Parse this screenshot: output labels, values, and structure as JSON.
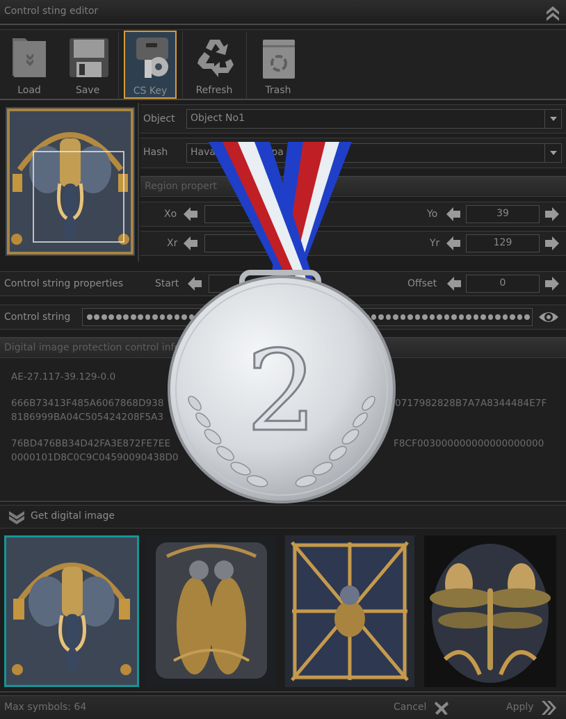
{
  "window": {
    "title": "Control sting editor",
    "collapse_icon": "double-chevron-up-icon"
  },
  "toolbar": {
    "buttons": [
      {
        "label": "Load",
        "icon": "folder-load-icon",
        "active": false
      },
      {
        "label": "Save",
        "icon": "floppy-disk-icon",
        "active": false
      },
      {
        "label": "CS Key",
        "icon": "key-gear-icon",
        "active": true
      },
      {
        "label": "Refresh",
        "icon": "recycle-icon",
        "active": false
      },
      {
        "label": "Trash",
        "icon": "trash-bin-icon",
        "active": false
      }
    ]
  },
  "object_panel": {
    "object_label": "Object",
    "object_value": "Object No1",
    "hash_label": "Hash",
    "hash_value_visible_start": "Hava",
    "hash_value_visible_end": "5 pa",
    "region_header": "Region propert",
    "xo_label": "Xo",
    "xo_value": "",
    "yo_label": "Yo",
    "yo_value": "39",
    "xr_label": "Xr",
    "xr_value": "1",
    "yr_label": "Yr",
    "yr_value": "129"
  },
  "control_string_properties": {
    "label": "Control string properties",
    "start_label": "Start",
    "start_value": "",
    "offset_label": "Offset",
    "offset_value": "0"
  },
  "control_string": {
    "label": "Control string",
    "masked": true,
    "visibility_icon": "eye-icon"
  },
  "info": {
    "header": "Digital image protection control info",
    "lines": [
      {
        "left": "AE-27.117-39.129-0.0",
        "right": ""
      },
      {
        "left": "666B73413F485A6067868D938",
        "right": "0717982828B7A7A8344484E7F"
      },
      {
        "left": "8186999BA04C505424208F5A3",
        "right": ""
      },
      {
        "left": "76BD476BB34D42FA3E872FE7EE",
        "right": "F8CF003000000000000000000"
      },
      {
        "left": "0000101D8C0C9C04590090438D0",
        "right": ""
      }
    ]
  },
  "get_image": {
    "label": "Get digital image",
    "icon": "double-chevron-down-icon"
  },
  "gallery": {
    "items": [
      {
        "name": "elephant",
        "selected": true
      },
      {
        "name": "birds",
        "selected": false
      },
      {
        "name": "spider",
        "selected": false
      },
      {
        "name": "dragonfly",
        "selected": false
      }
    ],
    "selected_color": "#159696"
  },
  "status": {
    "max_symbols": "Max symbols: 64",
    "cancel": "Cancel",
    "apply": "Apply"
  },
  "overlay": {
    "medal_number": "2",
    "ribbon_colors": [
      "#1f3fc8",
      "#c01f25",
      "#e8eef2"
    ]
  },
  "theme": {
    "accent_active_border": "#d79a3a",
    "active_bg": "#2e4050"
  }
}
